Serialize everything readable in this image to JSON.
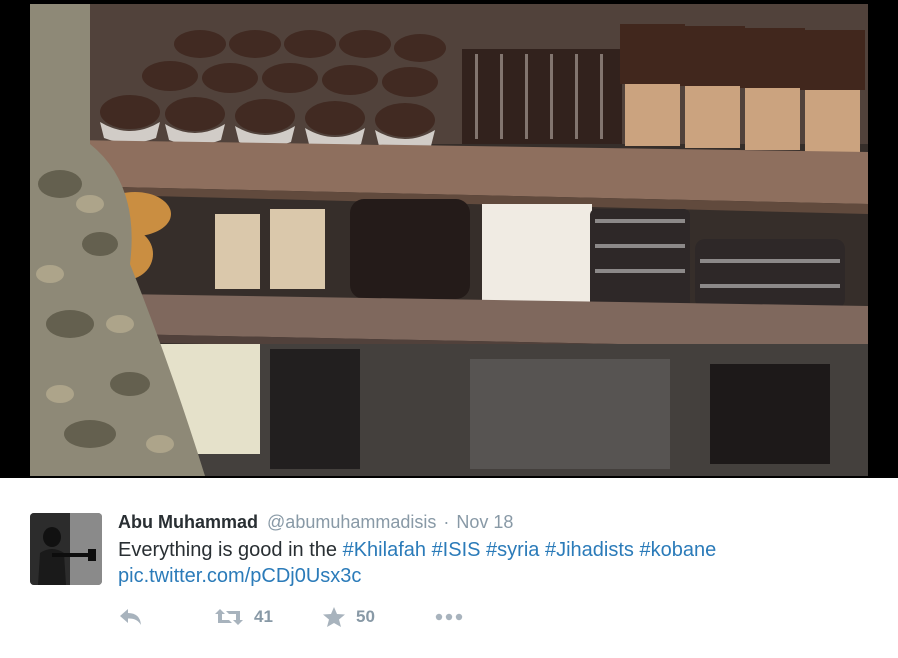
{
  "tweet": {
    "display_name": "Abu Muhammad",
    "handle": "@abumuhammadisis",
    "separator": "·",
    "time": "Nov 18",
    "text_prefix": "Everything is good in the ",
    "hashtags": [
      "#Khilafah",
      "#ISIS",
      "#syria",
      "#Jihadists",
      "#kobane"
    ],
    "media_link": "pic.twitter.com/pCDj0Usx3c"
  },
  "actions": {
    "reply_icon": "reply-arrow-icon",
    "retweet_icon": "retweet-icon",
    "retweet_count": "41",
    "favorite_icon": "star-icon",
    "favorite_count": "50",
    "more_icon": "ellipsis-icon"
  },
  "colors": {
    "link": "#2b7bb9",
    "text": "#292f33",
    "muted": "#8899a6",
    "icon": "#a8b3bd"
  }
}
